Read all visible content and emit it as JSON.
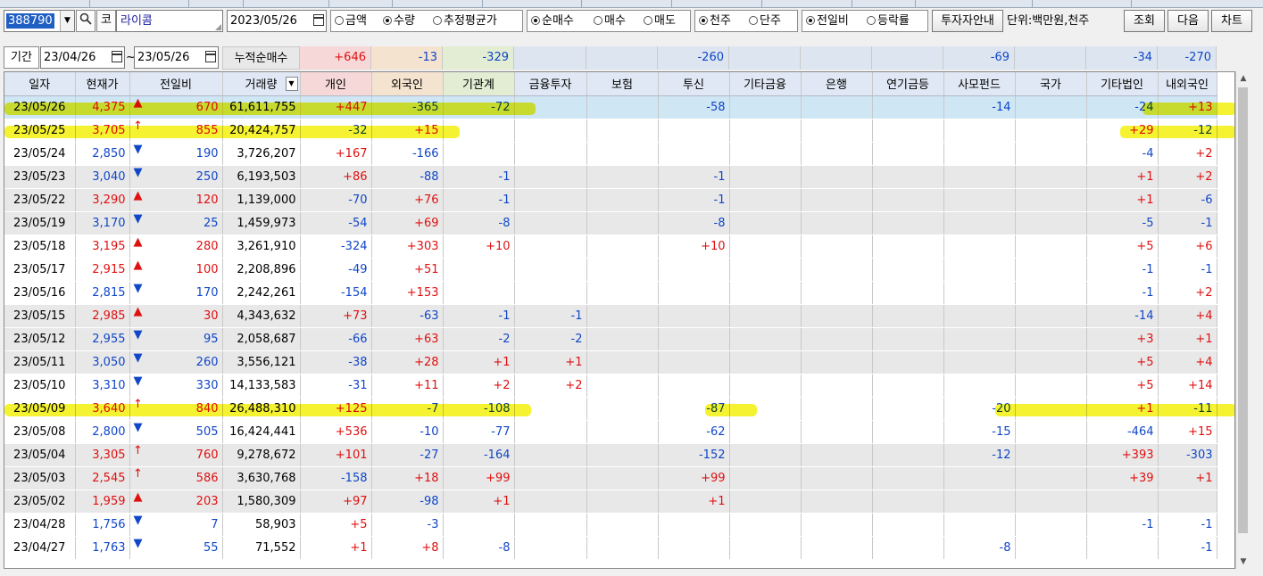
{
  "toolbar": {
    "code": "388790",
    "market_label": "코",
    "name": "라이콤",
    "date": "2023/05/26",
    "radio_value": [
      {
        "label": "금액",
        "on": false
      },
      {
        "label": "수량",
        "on": true
      },
      {
        "label": "추정평균가",
        "on": false
      }
    ],
    "radio_trade": [
      {
        "label": "순매수",
        "on": true
      },
      {
        "label": "매수",
        "on": false
      },
      {
        "label": "매도",
        "on": false
      }
    ],
    "radio_unit": [
      {
        "label": "천주",
        "on": true
      },
      {
        "label": "단주",
        "on": false
      }
    ],
    "radio_compare": [
      {
        "label": "전일비",
        "on": true
      },
      {
        "label": "등락률",
        "on": false
      }
    ],
    "guide_button": "투자자안내",
    "unit_text": "단위:백만원,천주",
    "query_button": "조회",
    "next_button": "다음",
    "chart_button": "차트"
  },
  "period": {
    "label": "기간",
    "from": "23/04/26",
    "to": "23/05/26",
    "tilde": "~"
  },
  "summary": {
    "label": "누적순매수",
    "values": [
      "+646",
      "-13",
      "-329",
      "",
      "",
      "-260",
      "",
      "",
      "",
      "-69",
      "",
      "-34",
      "-270"
    ]
  },
  "columns": [
    "일자",
    "현재가",
    "전일비",
    "거래량",
    "개인",
    "외국인",
    "기관계",
    "금융투자",
    "보험",
    "투신",
    "기타금융",
    "은행",
    "연기금등",
    "사모펀드",
    "국가",
    "기타법인",
    "내외국인"
  ],
  "colors": {
    "up": "#e01010",
    "down": "#1046c8",
    "highlight": "#f4f10c"
  },
  "rows": [
    {
      "date": "23/05/26",
      "price": "4,375",
      "dir": "up",
      "arrow": "▲",
      "chg": "670",
      "vol": "61,611,755",
      "v": [
        "+447",
        "-365",
        "-72",
        "",
        "",
        "-58",
        "",
        "",
        "",
        "-14",
        "",
        "-24",
        "+13"
      ],
      "bg": "b"
    },
    {
      "date": "23/05/25",
      "price": "3,705",
      "dir": "up",
      "arrow": "↑",
      "chg": "855",
      "vol": "20,424,757",
      "v": [
        "-32",
        "+15",
        "",
        "",
        "",
        "",
        "",
        "",
        "",
        "",
        "",
        "+29",
        "-12"
      ],
      "bg": "w"
    },
    {
      "date": "23/05/24",
      "price": "2,850",
      "dir": "dn",
      "arrow": "▼",
      "chg": "190",
      "vol": "3,726,207",
      "v": [
        "+167",
        "-166",
        "",
        "",
        "",
        "",
        "",
        "",
        "",
        "",
        "",
        "-4",
        "+2"
      ],
      "bg": "w"
    },
    {
      "date": "23/05/23",
      "price": "3,040",
      "dir": "dn",
      "arrow": "▼",
      "chg": "250",
      "vol": "6,193,503",
      "v": [
        "+86",
        "-88",
        "-1",
        "",
        "",
        "-1",
        "",
        "",
        "",
        "",
        "",
        "+1",
        "+2"
      ],
      "bg": "g"
    },
    {
      "date": "23/05/22",
      "price": "3,290",
      "dir": "up",
      "arrow": "▲",
      "chg": "120",
      "vol": "1,139,000",
      "v": [
        "-70",
        "+76",
        "-1",
        "",
        "",
        "-1",
        "",
        "",
        "",
        "",
        "",
        "+1",
        "-6"
      ],
      "bg": "g"
    },
    {
      "date": "23/05/19",
      "price": "3,170",
      "dir": "dn",
      "arrow": "▼",
      "chg": "25",
      "vol": "1,459,973",
      "v": [
        "-54",
        "+69",
        "-8",
        "",
        "",
        "-8",
        "",
        "",
        "",
        "",
        "",
        "-5",
        "-1"
      ],
      "bg": "g"
    },
    {
      "date": "23/05/18",
      "price": "3,195",
      "dir": "up",
      "arrow": "▲",
      "chg": "280",
      "vol": "3,261,910",
      "v": [
        "-324",
        "+303",
        "+10",
        "",
        "",
        "+10",
        "",
        "",
        "",
        "",
        "",
        "+5",
        "+6"
      ],
      "bg": "w"
    },
    {
      "date": "23/05/17",
      "price": "2,915",
      "dir": "up",
      "arrow": "▲",
      "chg": "100",
      "vol": "2,208,896",
      "v": [
        "-49",
        "+51",
        "",
        "",
        "",
        "",
        "",
        "",
        "",
        "",
        "",
        "-1",
        "-1"
      ],
      "bg": "w"
    },
    {
      "date": "23/05/16",
      "price": "2,815",
      "dir": "dn",
      "arrow": "▼",
      "chg": "170",
      "vol": "2,242,261",
      "v": [
        "-154",
        "+153",
        "",
        "",
        "",
        "",
        "",
        "",
        "",
        "",
        "",
        "-1",
        "+2"
      ],
      "bg": "w"
    },
    {
      "date": "23/05/15",
      "price": "2,985",
      "dir": "up",
      "arrow": "▲",
      "chg": "30",
      "vol": "4,343,632",
      "v": [
        "+73",
        "-63",
        "-1",
        "-1",
        "",
        "",
        "",
        "",
        "",
        "",
        "",
        "-14",
        "+4"
      ],
      "bg": "g"
    },
    {
      "date": "23/05/12",
      "price": "2,955",
      "dir": "dn",
      "arrow": "▼",
      "chg": "95",
      "vol": "2,058,687",
      "v": [
        "-66",
        "+63",
        "-2",
        "-2",
        "",
        "",
        "",
        "",
        "",
        "",
        "",
        "+3",
        "+1"
      ],
      "bg": "g"
    },
    {
      "date": "23/05/11",
      "price": "3,050",
      "dir": "dn",
      "arrow": "▼",
      "chg": "260",
      "vol": "3,556,121",
      "v": [
        "-38",
        "+28",
        "+1",
        "+1",
        "",
        "",
        "",
        "",
        "",
        "",
        "",
        "+5",
        "+4"
      ],
      "bg": "g"
    },
    {
      "date": "23/05/10",
      "price": "3,310",
      "dir": "dn",
      "arrow": "▼",
      "chg": "330",
      "vol": "14,133,583",
      "v": [
        "-31",
        "+11",
        "+2",
        "+2",
        "",
        "",
        "",
        "",
        "",
        "",
        "",
        "+5",
        "+14"
      ],
      "bg": "w"
    },
    {
      "date": "23/05/09",
      "price": "3,640",
      "dir": "up",
      "arrow": "↑",
      "chg": "840",
      "vol": "26,488,310",
      "v": [
        "+125",
        "-7",
        "-108",
        "",
        "",
        "-87",
        "",
        "",
        "",
        "-20",
        "",
        "+1",
        "-11"
      ],
      "bg": "w"
    },
    {
      "date": "23/05/08",
      "price": "2,800",
      "dir": "dn",
      "arrow": "▼",
      "chg": "505",
      "vol": "16,424,441",
      "v": [
        "+536",
        "-10",
        "-77",
        "",
        "",
        "-62",
        "",
        "",
        "",
        "-15",
        "",
        "-464",
        "+15"
      ],
      "bg": "w"
    },
    {
      "date": "23/05/04",
      "price": "3,305",
      "dir": "up",
      "arrow": "↑",
      "chg": "760",
      "vol": "9,278,672",
      "v": [
        "+101",
        "-27",
        "-164",
        "",
        "",
        "-152",
        "",
        "",
        "",
        "-12",
        "",
        "+393",
        "-303"
      ],
      "bg": "g"
    },
    {
      "date": "23/05/03",
      "price": "2,545",
      "dir": "up",
      "arrow": "↑",
      "chg": "586",
      "vol": "3,630,768",
      "v": [
        "-158",
        "+18",
        "+99",
        "",
        "",
        "+99",
        "",
        "",
        "",
        "",
        "",
        "+39",
        "+1"
      ],
      "bg": "g"
    },
    {
      "date": "23/05/02",
      "price": "1,959",
      "dir": "up",
      "arrow": "▲",
      "chg": "203",
      "vol": "1,580,309",
      "v": [
        "+97",
        "-98",
        "+1",
        "",
        "",
        "+1",
        "",
        "",
        "",
        "",
        "",
        "",
        ""
      ],
      "bg": "g"
    },
    {
      "date": "23/04/28",
      "price": "1,756",
      "dir": "dn",
      "arrow": "▼",
      "chg": "7",
      "vol": "58,903",
      "v": [
        "+5",
        "-3",
        "",
        "",
        "",
        "",
        "",
        "",
        "",
        "",
        "",
        "-1",
        "-1"
      ],
      "bg": "w"
    },
    {
      "date": "23/04/27",
      "price": "1,763",
      "dir": "dn",
      "arrow": "▼",
      "chg": "55",
      "vol": "71,552",
      "v": [
        "+1",
        "+8",
        "-8",
        "",
        "",
        "",
        "",
        "",
        "",
        "-8",
        "",
        "",
        "-1"
      ],
      "bg": "w"
    }
  ]
}
